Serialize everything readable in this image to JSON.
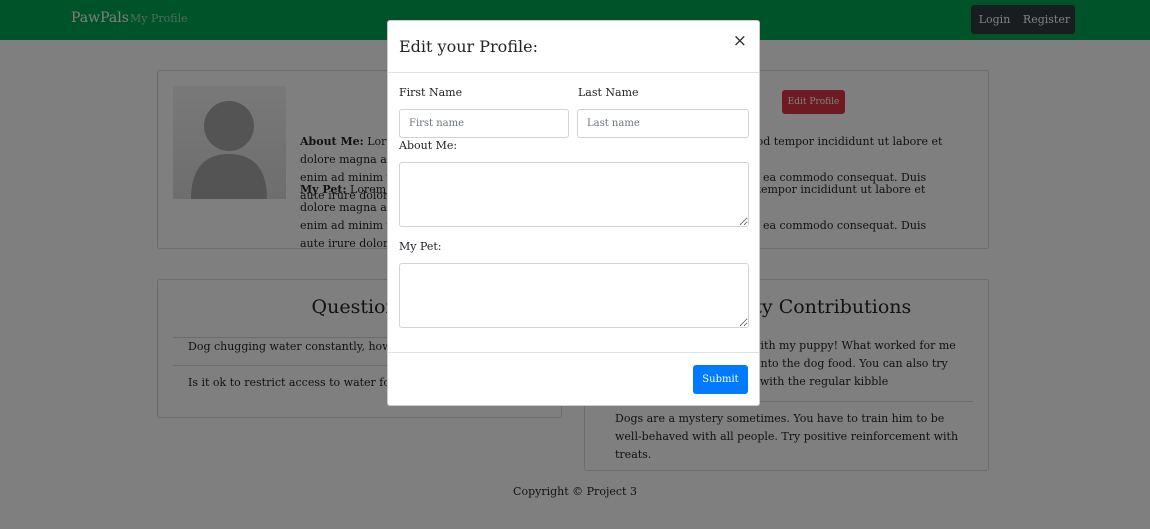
{
  "navbar": {
    "brand": "PawPals",
    "my_profile_link": "My Profile",
    "login_label": "Login",
    "register_label": "Register"
  },
  "profile": {
    "edit_button_label": "Edit Profile",
    "about_label": "About Me:",
    "about_visible_left": "Lorem ipsum dolor sit amet, consectetur adipiscing elit, sed do eiusmod tempor incididunt ut labore et dolore magna aliqua. Ut",
    "about_visible_line2": "enim ad minim veniam, quis nostrud exercitation ullamco laboris nisi ut aliquip ex ea commodo consequat. Duis aute irure dolor i",
    "pet_label": "My Pet:",
    "pet_visible_left": "Lorem ipsum dolor sit amet, consectetur adipiscing elit, sed do eiusmod tempor incididunt ut labore et dolore magna aliqua. Ut",
    "pet_visible_line2": "enim ad minim veniam, quis nostrud exercitation ullamco laboris nisi ut aliquip ex ea commodo consequat. Duis aute irure dolor i"
  },
  "questions": {
    "title": "Questions",
    "items": [
      "Dog chugging water constantly, how do I help him?",
      "Is it ok to restrict access to water for toilet training?"
    ]
  },
  "contributions": {
    "title": "Community Contributions",
    "items": [
      "I had the same problem with my puppy! What worked for me was adding a little water into the dog food. You can also try adding wet food together with the regular kibble",
      "Dogs are a mystery sometimes. You have to train him to be well-behaved with all people. Try positive reinforcement with treats."
    ]
  },
  "footer": {
    "text": "Copyright © Project 3"
  },
  "modal": {
    "title": "Edit your Profile:",
    "close_symbol": "×",
    "first_name_label": "First Name",
    "first_name_placeholder": "First name",
    "first_name_value": "",
    "last_name_label": "Last Name",
    "last_name_placeholder": "Last name",
    "last_name_value": "",
    "about_label": "About Me:",
    "about_value": "",
    "pet_label": "My Pet:",
    "pet_value": "",
    "submit_label": "Submit"
  },
  "colors": {
    "navbar": "#00a651",
    "edit_button": "#dc3545",
    "submit_button": "#007bff",
    "nav_buttons": "#343a40"
  }
}
